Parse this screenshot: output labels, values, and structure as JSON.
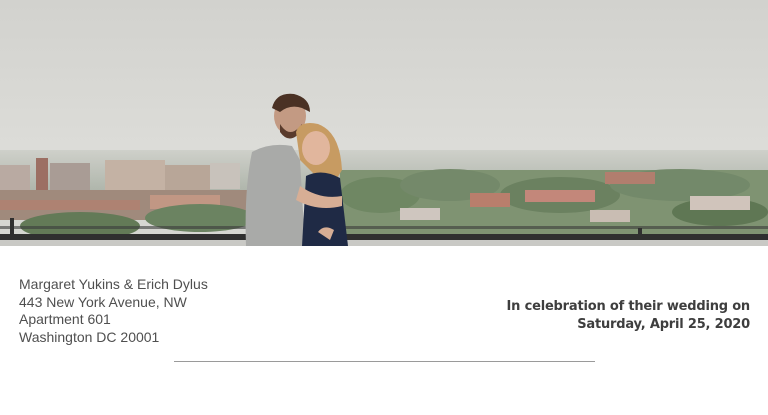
{
  "address": {
    "names": "Margaret Yukins & Erich Dylus",
    "street": "443 New York Avenue, NW",
    "apartment": "Apartment 601",
    "city": "Washington DC  20001"
  },
  "celebration": {
    "line1": "In celebration of their wedding on",
    "line2": "Saturday, April 25, 2020"
  },
  "colors": {
    "sky": "#d7d7d3",
    "text_address": "#4f4f4f",
    "text_celebration": "#3e3e3e",
    "divider": "#9a9a9a"
  }
}
